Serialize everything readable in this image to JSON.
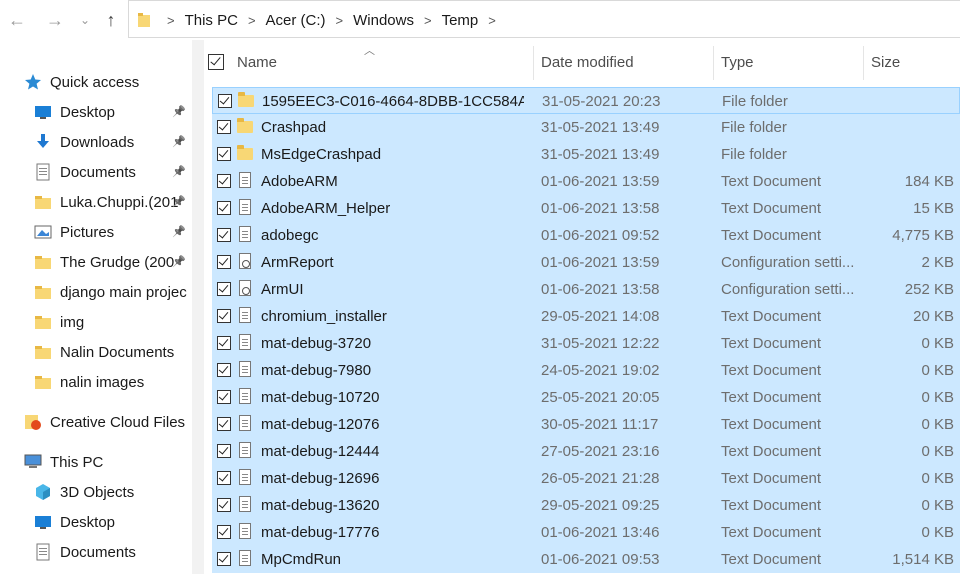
{
  "breadcrumbs": [
    "This PC",
    "Acer (C:)",
    "Windows",
    "Temp"
  ],
  "sidebar": {
    "items": [
      {
        "label": "Quick access",
        "icon": "star-icon",
        "indent": false,
        "pinned": false
      },
      {
        "label": "Desktop",
        "icon": "desktop-icon",
        "indent": true,
        "pinned": true
      },
      {
        "label": "Downloads",
        "icon": "download-icon",
        "indent": true,
        "pinned": true
      },
      {
        "label": "Documents",
        "icon": "documents-icon",
        "indent": true,
        "pinned": true
      },
      {
        "label": "Luka.Chuppi.(201",
        "icon": "folder-icon",
        "indent": true,
        "pinned": true
      },
      {
        "label": "Pictures",
        "icon": "pictures-icon",
        "indent": true,
        "pinned": true
      },
      {
        "label": "The Grudge (200",
        "icon": "folder-icon",
        "indent": true,
        "pinned": true
      },
      {
        "label": "django main projec",
        "icon": "folder-icon",
        "indent": true,
        "pinned": false
      },
      {
        "label": "img",
        "icon": "folder-icon",
        "indent": true,
        "pinned": false
      },
      {
        "label": "Nalin Documents",
        "icon": "folder-icon",
        "indent": true,
        "pinned": false
      },
      {
        "label": "nalin images",
        "icon": "folder-icon",
        "indent": true,
        "pinned": false
      },
      {
        "label": "Creative Cloud Files",
        "icon": "creative-cloud-icon",
        "indent": false,
        "pinned": false
      },
      {
        "label": "This PC",
        "icon": "computer-icon",
        "indent": false,
        "pinned": false
      },
      {
        "label": "3D Objects",
        "icon": "cube-icon",
        "indent": true,
        "pinned": false
      },
      {
        "label": "Desktop",
        "icon": "desktop-icon",
        "indent": true,
        "pinned": false
      },
      {
        "label": "Documents",
        "icon": "documents-icon",
        "indent": true,
        "pinned": false
      }
    ]
  },
  "columns": {
    "name": "Name",
    "date": "Date modified",
    "type": "Type",
    "size": "Size"
  },
  "files": [
    {
      "name": "1595EEC3-C016-4664-8DBB-1CC584A...",
      "date": "31-05-2021 20:23",
      "type": "File folder",
      "size": "",
      "kind": "folder"
    },
    {
      "name": "Crashpad",
      "date": "31-05-2021 13:49",
      "type": "File folder",
      "size": "",
      "kind": "folder"
    },
    {
      "name": "MsEdgeCrashpad",
      "date": "31-05-2021 13:49",
      "type": "File folder",
      "size": "",
      "kind": "folder"
    },
    {
      "name": "AdobeARM",
      "date": "01-06-2021 13:59",
      "type": "Text Document",
      "size": "184 KB",
      "kind": "text"
    },
    {
      "name": "AdobeARM_Helper",
      "date": "01-06-2021 13:58",
      "type": "Text Document",
      "size": "15 KB",
      "kind": "text"
    },
    {
      "name": "adobegc",
      "date": "01-06-2021 09:52",
      "type": "Text Document",
      "size": "4,775 KB",
      "kind": "text"
    },
    {
      "name": "ArmReport",
      "date": "01-06-2021 13:59",
      "type": "Configuration setti...",
      "size": "2 KB",
      "kind": "config"
    },
    {
      "name": "ArmUI",
      "date": "01-06-2021 13:58",
      "type": "Configuration setti...",
      "size": "252 KB",
      "kind": "config"
    },
    {
      "name": "chromium_installer",
      "date": "29-05-2021 14:08",
      "type": "Text Document",
      "size": "20 KB",
      "kind": "text"
    },
    {
      "name": "mat-debug-3720",
      "date": "31-05-2021 12:22",
      "type": "Text Document",
      "size": "0 KB",
      "kind": "text"
    },
    {
      "name": "mat-debug-7980",
      "date": "24-05-2021 19:02",
      "type": "Text Document",
      "size": "0 KB",
      "kind": "text"
    },
    {
      "name": "mat-debug-10720",
      "date": "25-05-2021 20:05",
      "type": "Text Document",
      "size": "0 KB",
      "kind": "text"
    },
    {
      "name": "mat-debug-12076",
      "date": "30-05-2021 11:17",
      "type": "Text Document",
      "size": "0 KB",
      "kind": "text"
    },
    {
      "name": "mat-debug-12444",
      "date": "27-05-2021 23:16",
      "type": "Text Document",
      "size": "0 KB",
      "kind": "text"
    },
    {
      "name": "mat-debug-12696",
      "date": "26-05-2021 21:28",
      "type": "Text Document",
      "size": "0 KB",
      "kind": "text"
    },
    {
      "name": "mat-debug-13620",
      "date": "29-05-2021 09:25",
      "type": "Text Document",
      "size": "0 KB",
      "kind": "text"
    },
    {
      "name": "mat-debug-17776",
      "date": "01-06-2021 13:46",
      "type": "Text Document",
      "size": "0 KB",
      "kind": "text"
    },
    {
      "name": "MpCmdRun",
      "date": "01-06-2021 09:53",
      "type": "Text Document",
      "size": "1,514 KB",
      "kind": "text"
    }
  ],
  "colors": {
    "selection": "#cce8ff",
    "selection_border": "#99d1ff",
    "folder": "#f8d775"
  }
}
